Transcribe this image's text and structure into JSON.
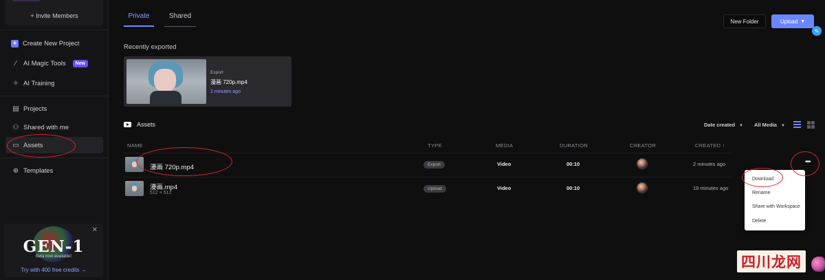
{
  "sidebar": {
    "invite_label": "+ Invite Members",
    "items": [
      {
        "label": "Create New Project",
        "icon": "plus-icon"
      },
      {
        "label": "AI Magic Tools",
        "icon": "magic-wand-icon",
        "badge": "New"
      },
      {
        "label": "AI Training",
        "icon": "sparkle-icon"
      },
      {
        "label": "Projects",
        "icon": "projects-icon"
      },
      {
        "label": "Shared with me",
        "icon": "users-icon"
      },
      {
        "label": "Assets",
        "icon": "folder-icon"
      },
      {
        "label": "Templates",
        "icon": "globe-icon"
      }
    ],
    "promo": {
      "title": "GEN-1",
      "subtitle": "Beta now available!",
      "cta": "Try with 400 free credits →"
    }
  },
  "tabs": [
    {
      "label": "Private",
      "active": true
    },
    {
      "label": "Shared",
      "active": false
    }
  ],
  "toolbar": {
    "new_folder": "New Folder",
    "upload": "Upload"
  },
  "recent": {
    "section_label": "Recently exported",
    "card": {
      "kind": "Export",
      "name": "漫画 720p.mp4",
      "time": "2 minutes ago"
    }
  },
  "assets": {
    "heading": "Assets",
    "filter_date": "Date created",
    "filter_media": "All Media",
    "columns": {
      "name": "NAME",
      "type": "TYPE",
      "media": "MEDIA",
      "duration": "DURATION",
      "creator": "CREATOR",
      "created": "CREATED ↑"
    },
    "rows": [
      {
        "name": "漫画 720p.mp4",
        "dims": "",
        "type": "Export",
        "media": "Video",
        "duration": "00:10",
        "created": "2 minutes ago"
      },
      {
        "name": "漫画.mp4",
        "dims": "512 × 512",
        "type": "Upload",
        "media": "Video",
        "duration": "00:10",
        "created": "19 minutes ago"
      }
    ]
  },
  "context_menu": {
    "items": [
      "Download",
      "Rename",
      "Share with Workspace",
      "Delete"
    ]
  },
  "watermark": "四川龙网",
  "colors": {
    "accent": "#6b87ff",
    "annotation": "#d8262a"
  }
}
